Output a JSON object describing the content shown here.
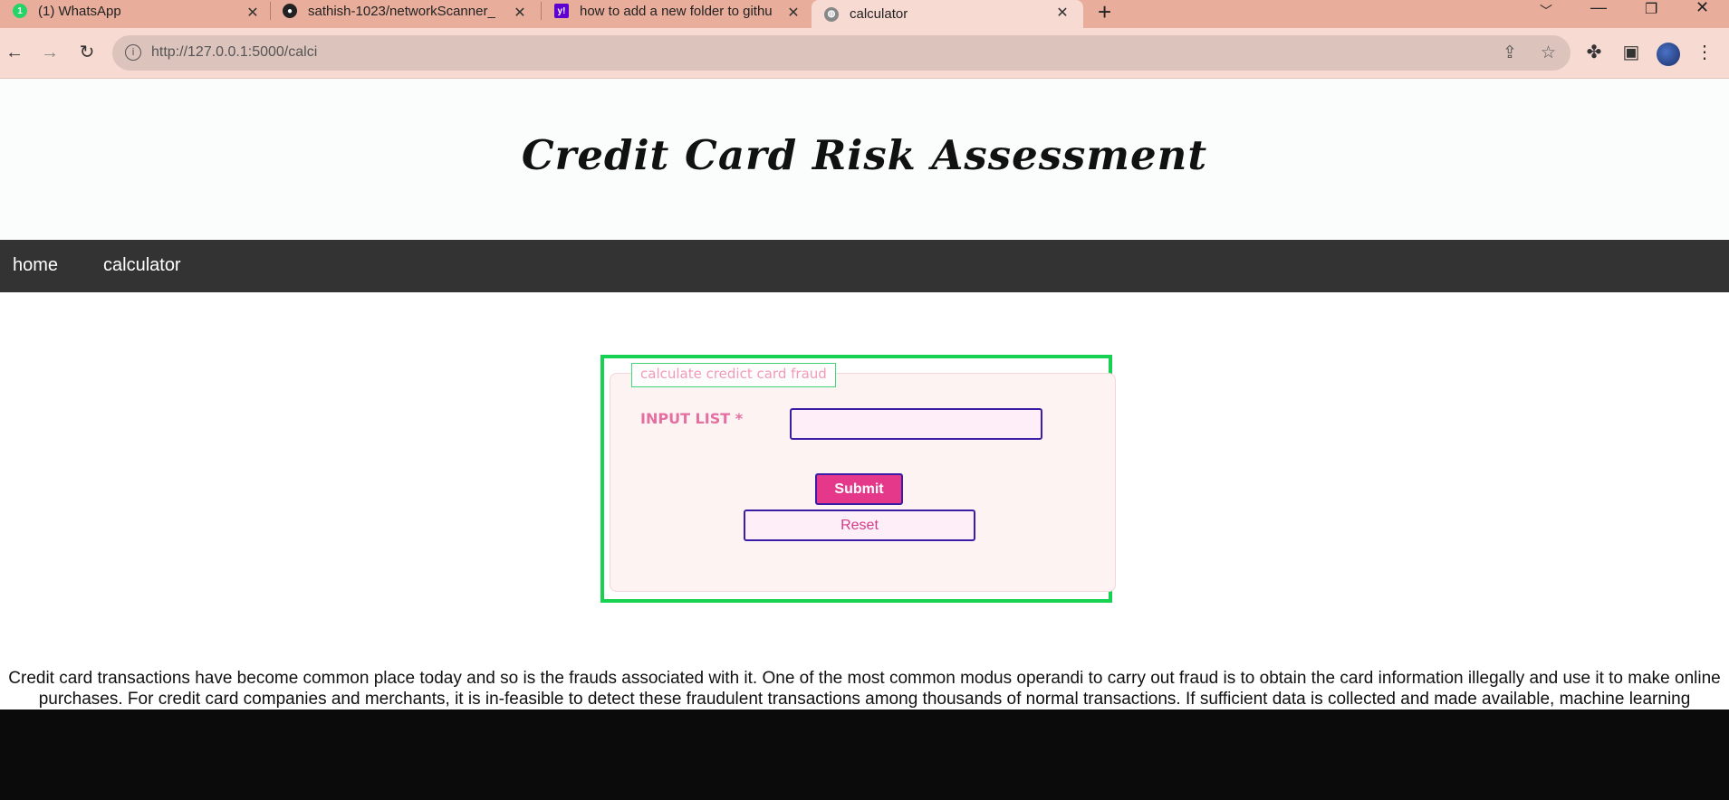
{
  "browser": {
    "tabs": [
      {
        "title": "(1) WhatsApp",
        "icon": "whatsapp-icon",
        "active": false
      },
      {
        "title": "sathish-1023/networkScanner_",
        "icon": "github-icon",
        "active": false
      },
      {
        "title": "how to add a new folder to githu",
        "icon": "yahoo-icon",
        "active": false
      },
      {
        "title": "calculator",
        "icon": "globe-icon",
        "active": true
      }
    ],
    "url": "http://127.0.0.1:5000/calci"
  },
  "page": {
    "title": "Credit Card Risk Assessment",
    "nav": {
      "home": "home",
      "calculator": "calculator"
    },
    "form": {
      "legend": "calculate credict card fraud",
      "input_label": "INPUT LIST *",
      "input_value": "",
      "submit": "Submit",
      "reset": "Reset"
    },
    "description": "Credit card transactions have become common place today and so is the frauds associated with it. One of the most common modus operandi to carry out fraud is to obtain the card information illegally and use it to make online purchases. For credit card companies and merchants, it is in-feasible to detect these fraudulent transactions among thousands of normal transactions. If sufficient data is collected and made available, machine learning algorithms can be applied to solve this problem. In this work, popular supervised and unsupervised machine learning algorithms have been applied to detect credit card frauds in a highly imbalanced dataset. It was found that unsupervised machine learning algorithms can handle the skewness and give best classification results."
  },
  "colors": {
    "tabstrip": "#e9ad9c",
    "nav": "#333333",
    "form_border": "#16d152",
    "submit_bg": "#e5388a",
    "button_border": "#3a1fa6"
  }
}
